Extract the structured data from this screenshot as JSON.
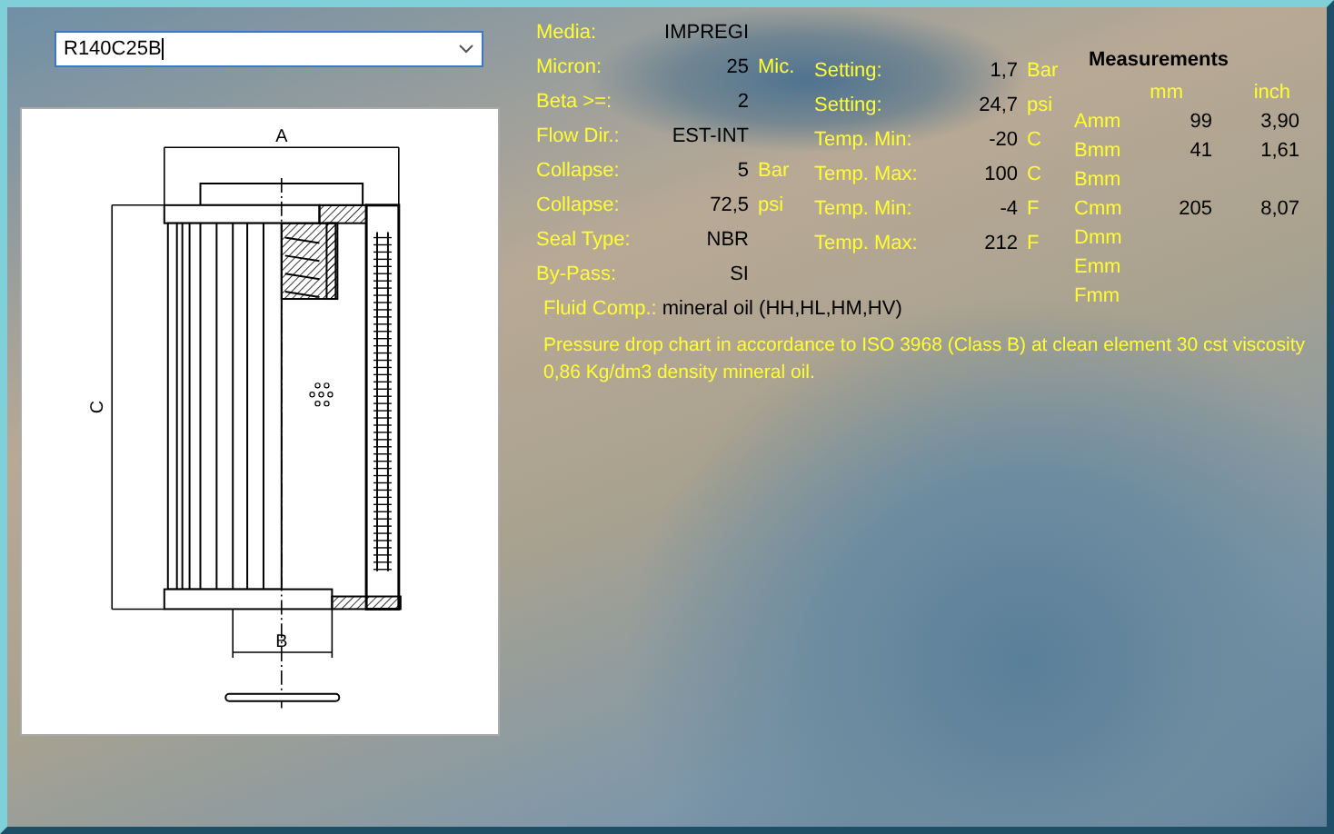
{
  "product_field": {
    "value": "R140C25B"
  },
  "drawing": {
    "dimension_labels": [
      "A",
      "B",
      "C"
    ]
  },
  "specs": [
    {
      "label": "Media:",
      "value": "IMPREGI"
    },
    {
      "label": "Micron:",
      "value": "25",
      "unit": "Mic."
    },
    {
      "label": "Beta >=:",
      "value": "2"
    },
    {
      "label": "Flow Dir.:",
      "value": "EST-INT"
    },
    {
      "label": "Collapse:",
      "value": "5",
      "unit": "Bar"
    },
    {
      "label": "Collapse:",
      "value": "72,5",
      "unit": "psi"
    },
    {
      "label": "Seal Type:",
      "value": "NBR"
    },
    {
      "label": "By-Pass:",
      "value": "SI"
    }
  ],
  "settings": [
    {
      "label": "Setting:",
      "value": "1,7",
      "unit": "Bar"
    },
    {
      "label": "Setting:",
      "value": "24,7",
      "unit": "psi"
    },
    {
      "label": "Temp. Min:",
      "value": "-20",
      "unit": "C"
    },
    {
      "label": "Temp. Max:",
      "value": "100",
      "unit": "C"
    },
    {
      "label": "Temp. Min:",
      "value": "-4",
      "unit": "F"
    },
    {
      "label": "Temp. Max:",
      "value": "212",
      "unit": "F"
    }
  ],
  "fluid": {
    "label": "Fluid Comp.:",
    "value": "mineral oil (HH,HL,HM,HV)"
  },
  "note": "Pressure drop chart in accordance to ISO 3968 (Class B) at clean element 30 cst viscosity 0,86 Kg/dm3 density mineral oil.",
  "measurements": {
    "title": "Measurements",
    "columns": [
      "mm",
      "inch"
    ],
    "rows": [
      {
        "label": "Amm",
        "mm": "99",
        "inch": "3,90"
      },
      {
        "label": "Bmm",
        "mm": "41",
        "inch": "1,61"
      },
      {
        "label": "Bmm"
      },
      {
        "label": "Cmm",
        "mm": "205",
        "inch": "8,07"
      },
      {
        "label": "Dmm"
      },
      {
        "label": "Emm"
      },
      {
        "label": "Fmm"
      }
    ]
  }
}
